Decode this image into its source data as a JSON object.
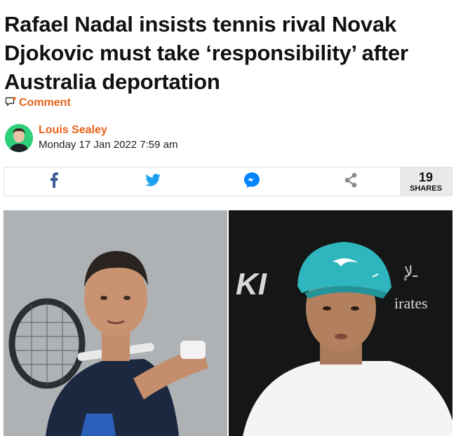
{
  "article": {
    "headline": "Rafael Nadal insists tennis rival Novak Djokovic must take ‘responsibility’ after Australia deportation",
    "comment_label": "Comment"
  },
  "author": {
    "name": "Louis Sealey",
    "date": "Monday 17 Jan 2022 7:59 am"
  },
  "share": {
    "count": "19",
    "label": "SHARES",
    "buttons": [
      "facebook-icon",
      "twitter-icon",
      "messenger-icon",
      "share-icon"
    ]
  },
  "photo": {
    "left_sponsor_text": "KI",
    "right_sponsor_text": "irates"
  },
  "colors": {
    "accent": "#e8621a",
    "facebook": "#3b5998",
    "twitter": "#1da1f2",
    "messenger": "#0084ff",
    "share": "#8a8a8a"
  }
}
